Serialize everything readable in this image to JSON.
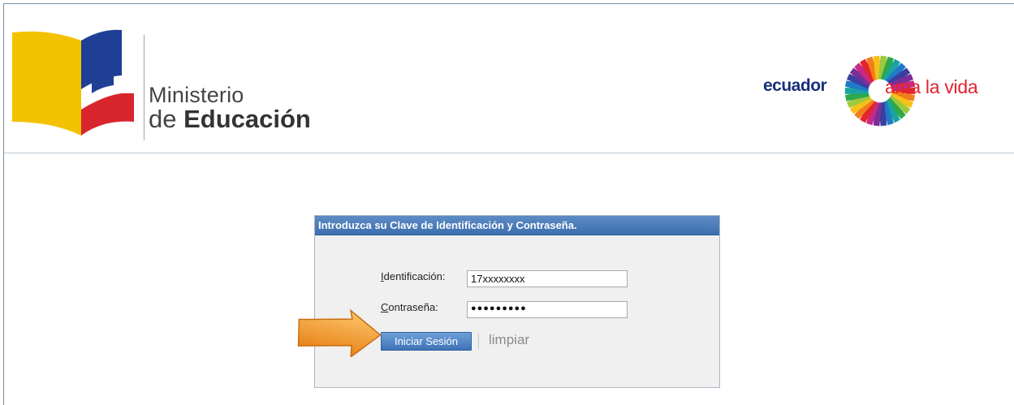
{
  "header": {
    "ministry": {
      "line1": "Ministerio",
      "line2_prefix": "de",
      "line2_bold": "Educación"
    },
    "brand": {
      "ecuador": "ecuador",
      "slogan": "ama la vida"
    }
  },
  "login": {
    "title": "Introduzca su Clave de Identificación y Contraseña.",
    "id_label_first": "I",
    "id_label_rest": "dentificación:",
    "id_value": "17xxxxxxxx",
    "pw_label_first": "C",
    "pw_label_rest": "ontraseña:",
    "pw_mask": "●●●●●●●●●",
    "submit_label": "Iniciar Sesión",
    "clear_label": "limpiar"
  },
  "colors": {
    "header_blue": "#3c6fb0",
    "flag_yellow": "#f2c200",
    "flag_blue": "#1f3f95",
    "flag_red": "#d8262c",
    "arrow_orange": "#f29a1e"
  },
  "icons": {
    "pointer": "arrow-pointer-icon"
  }
}
